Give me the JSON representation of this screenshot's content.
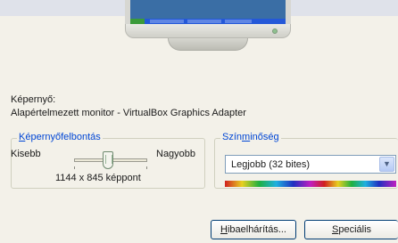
{
  "display": {
    "label": "Képernyő:",
    "value": "Alapértelmezett monitor - VirtualBox Graphics Adapter"
  },
  "resolution": {
    "group_title_accel": "K",
    "group_title_rest": "épernyőfelbontás",
    "smaller_label": "Kisebb",
    "larger_label": "Nagyobb",
    "value": "1144 x 845 képpont",
    "slider_level": 0.45
  },
  "color_quality": {
    "group_title_pre": "Szín",
    "group_title_accel": "m",
    "group_title_rest": "inőség",
    "selected": "Legjobb (32 bites)"
  },
  "buttons": {
    "troubleshoot_accel": "H",
    "troubleshoot_rest": "ibaelhárítás...",
    "advanced_accel": "S",
    "advanced_rest": "peciális"
  },
  "colors": {
    "group_title": "#0046d5",
    "background": "#f3f1e9",
    "desktop": "#3a6ea5"
  }
}
